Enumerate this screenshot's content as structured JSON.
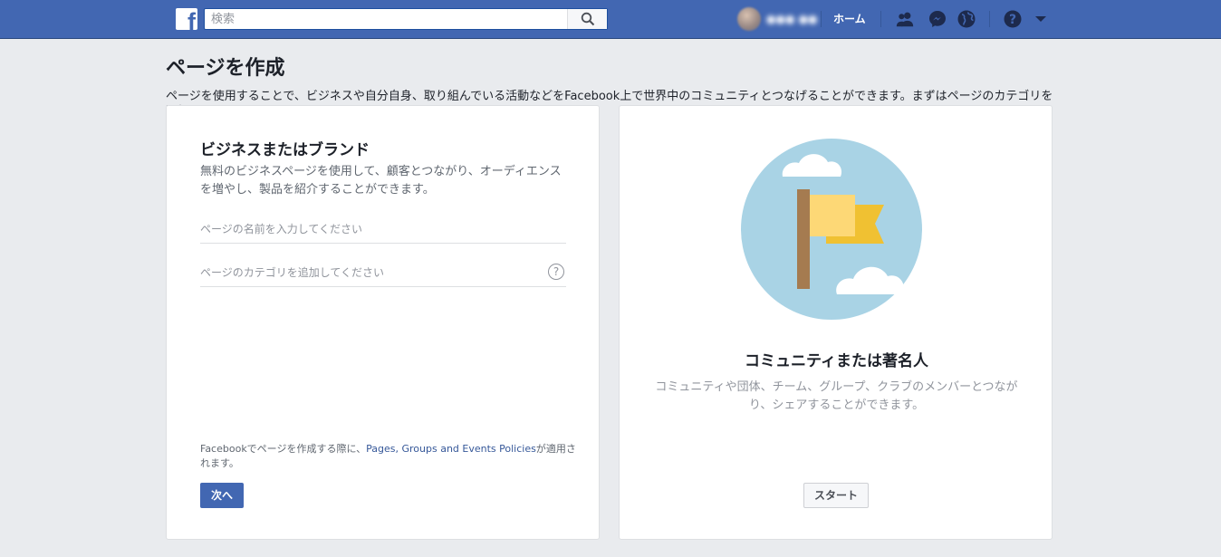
{
  "topbar": {
    "search_placeholder": "検索",
    "logo_letter": "f",
    "profile_name": "●●● ●●",
    "home_label": "ホーム"
  },
  "page": {
    "title": "ページを作成",
    "description": "ページを使用することで、ビジネスや自分自身、取り組んでいる活動などをFacebook上で世界中のコミュニティとつなげることができます。まずはページのカテゴリを選択してください。"
  },
  "business_card": {
    "title": "ビジネスまたはブランド",
    "subtitle": "無料のビジネスページを使用して、顧客とつながり、オーディエンスを増やし、製品を紹介することができます。",
    "name_placeholder": "ページの名前を入力してください",
    "category_placeholder": "ページのカテゴリを追加してください",
    "help_glyph": "?",
    "policy_prefix": "Facebookでページを作成する際に、",
    "policy_link": "Pages, Groups and Events Policies",
    "policy_suffix": "が適用されます。",
    "next_label": "次へ"
  },
  "community_card": {
    "title": "コミュニティまたは著名人",
    "subtitle": "コミュニティや団体、チーム、グループ、クラブのメンバーとつながり、シェアすることができます。",
    "start_label": "スタート"
  },
  "colors": {
    "topbar": "#4267b2",
    "background": "#e9ebee",
    "primary_button": "#4267b2",
    "link": "#365899",
    "illus_sky": "#a9d3e5",
    "flag_light": "#fdd876",
    "flag_dark": "#f0c132",
    "pole": "#a57b50"
  }
}
